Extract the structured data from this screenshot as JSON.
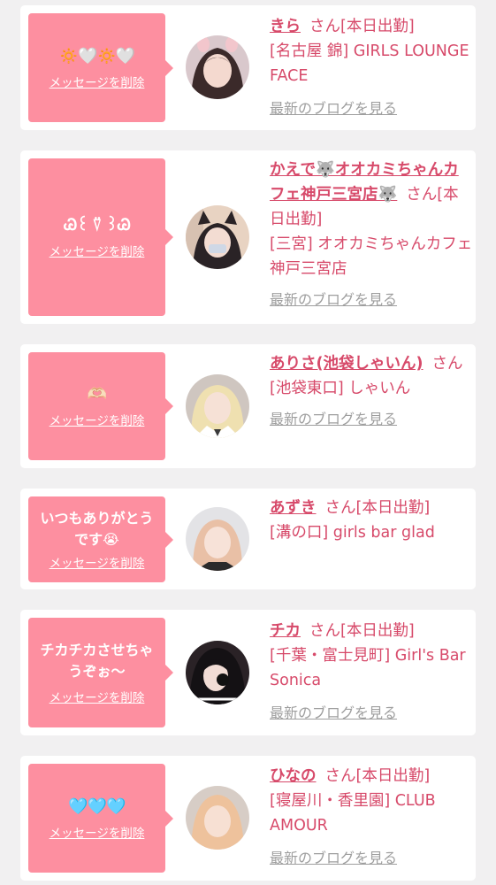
{
  "delete_label": "メッセージを削除",
  "blog_label": "最新のブログを見る",
  "honorific": "さん",
  "cards": [
    {
      "message": "🔅🤍🔅🤍",
      "name": "きら",
      "status": "[本日出勤]",
      "shop": "[名古屋 錦] GIRLS LOUNGE FACE"
    },
    {
      "message": "Ꮚ꒰ ⍢ ꒱Ꮚ",
      "name": "かえで🐺オオカミちゃんカフェ神戸三宮店🐺",
      "status": "[本日出勤]",
      "shop": "[三宮] オオカミちゃんカフェ神戸三宮店"
    },
    {
      "message": "🫶🏻",
      "name": "ありさ(池袋しゃいん)",
      "status": "",
      "shop": "[池袋東口] しゃいん"
    },
    {
      "message": "いつもありがとうです😭",
      "name": "あずき",
      "status": "[本日出勤]",
      "shop": "[溝の口] girls bar glad"
    },
    {
      "message": "チカチカさせちゃうぞぉ〜",
      "name": "チカ",
      "status": "[本日出勤]",
      "shop": "[千葉・富士見町] Girl's Bar Sonica"
    },
    {
      "message": "🩵🩵🩵",
      "name": "ひなの",
      "status": "[本日出勤]",
      "shop": "[寝屋川・香里園] CLUB AMOUR"
    }
  ],
  "colors": {
    "bubble": "#fd8fa0",
    "name": "#d74a6a",
    "blog_link": "#9e9e9e",
    "background": "#f1f0f1"
  }
}
